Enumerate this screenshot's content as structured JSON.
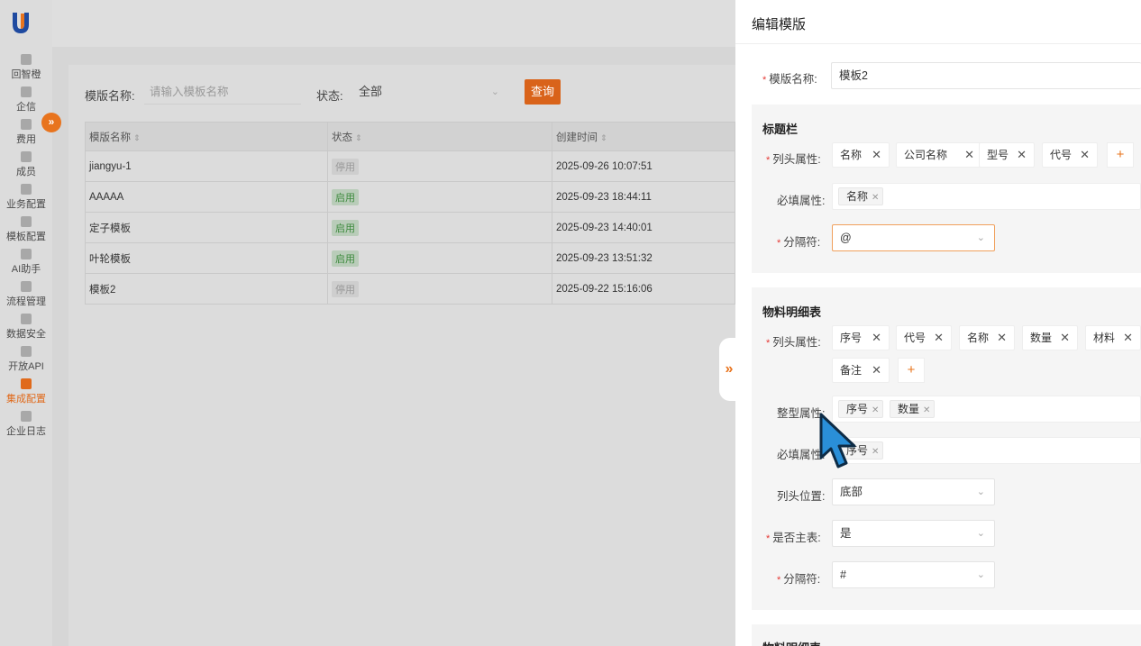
{
  "nav": {
    "items": [
      {
        "label": "回智橙",
        "icon": "back-icon"
      },
      {
        "label": "企信",
        "icon": "home-icon"
      },
      {
        "label": "费用",
        "icon": "coin-icon"
      },
      {
        "label": "成员",
        "icon": "user-icon"
      },
      {
        "label": "业务配置",
        "icon": "briefcase-icon"
      },
      {
        "label": "模板配置",
        "icon": "template-icon"
      },
      {
        "label": "AI助手",
        "icon": "robot-icon"
      },
      {
        "label": "流程管理",
        "icon": "flow-icon"
      },
      {
        "label": "数据安全",
        "icon": "database-icon"
      },
      {
        "label": "开放API",
        "icon": "api-icon"
      },
      {
        "label": "集成配置",
        "icon": "integration-icon"
      },
      {
        "label": "企业日志",
        "icon": "log-icon"
      }
    ],
    "active_index": 10,
    "toggle_label": "»"
  },
  "filter": {
    "name_label": "模版名称:",
    "name_placeholder": "请输入模板名称",
    "status_label": "状态:",
    "status_value": "全部",
    "query_label": "查询"
  },
  "table": {
    "headers": [
      "模版名称",
      "状态",
      "创建时间"
    ],
    "rows": [
      {
        "name": "jiangyu-1",
        "status": "停用",
        "created": "2025-09-26 10:07:51"
      },
      {
        "name": "AAAAA",
        "status": "启用",
        "created": "2025-09-23 18:44:11"
      },
      {
        "name": "定子模板",
        "status": "启用",
        "created": "2025-09-23 14:40:01"
      },
      {
        "name": "叶轮模板",
        "status": "启用",
        "created": "2025-09-23 13:51:32"
      },
      {
        "name": "模板2",
        "status": "停用",
        "created": "2025-09-22 15:16:06"
      }
    ]
  },
  "drawer": {
    "title": "编辑模版",
    "collapse_label": "»",
    "template_name_label": "模版名称:",
    "template_name_value": "模板2",
    "sections": [
      {
        "title": "标题栏",
        "column_attr_label": "列头属性:",
        "column_tags": [
          "名称",
          "公司名称",
          "型号",
          "代号"
        ],
        "required_label": "必填属性:",
        "required_chips": [
          "名称"
        ],
        "separator_label": "分隔符:",
        "separator_value": "@"
      },
      {
        "title": "物料明细表",
        "column_attr_label": "列头属性:",
        "column_tags": [
          "序号",
          "代号",
          "名称",
          "数量",
          "材料",
          "备注"
        ],
        "integer_label": "整型属性:",
        "integer_chips": [
          "序号",
          "数量"
        ],
        "required_label": "必填属性:",
        "required_chips": [
          "序号"
        ],
        "position_label": "列头位置:",
        "position_value": "底部",
        "is_main_label": "是否主表:",
        "is_main_value": "是",
        "separator_label": "分隔符:",
        "separator_value": "#"
      },
      {
        "title": "物料明细表"
      }
    ]
  },
  "colors": {
    "accent": "#e8741e",
    "query_button": "#d9631a",
    "enabled_text": "#3d8a3d"
  }
}
